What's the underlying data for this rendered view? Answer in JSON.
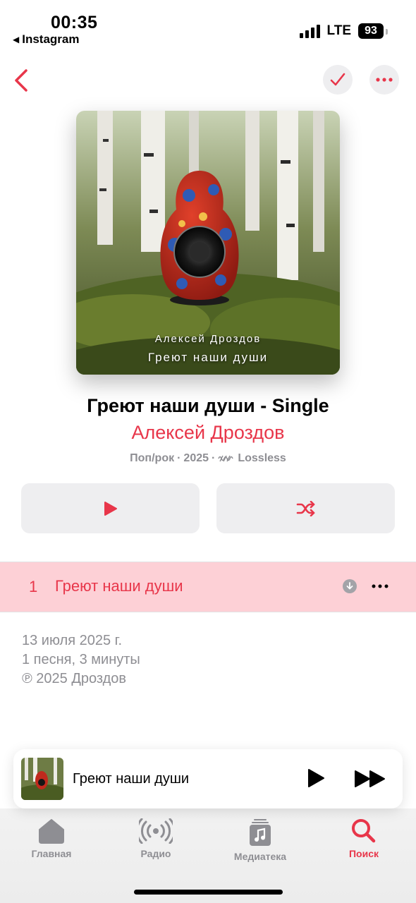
{
  "status_bar": {
    "time": "00:35",
    "back_app": "Instagram",
    "network": "LTE",
    "battery": "93"
  },
  "nav": {
    "back_icon": "chevron-left-icon",
    "check_icon": "checkmark-icon",
    "more_icon": "ellipsis-icon"
  },
  "artwork": {
    "artist_text": "Алексей Дроздов",
    "title_text": "Греют наши души"
  },
  "album": {
    "title": "Греют наши души - Single",
    "artist": "Алексей Дроздов",
    "genre": "Поп/рок",
    "year": "2025",
    "quality": "Lossless"
  },
  "actions": {
    "play_icon": "play-icon",
    "shuffle_icon": "shuffle-icon"
  },
  "tracks": [
    {
      "number": "1",
      "title": "Греют наши души"
    }
  ],
  "info": {
    "release_date": "13 июля 2025 г.",
    "summary": "1 песня, 3 минуты",
    "copyright": "℗ 2025 Дроздов"
  },
  "mini_player": {
    "title": "Греют наши души"
  },
  "tabs": [
    {
      "label": "Главная",
      "icon": "home-icon",
      "active": false
    },
    {
      "label": "Радио",
      "icon": "radio-icon",
      "active": false
    },
    {
      "label": "Медиатека",
      "icon": "library-icon",
      "active": false
    },
    {
      "label": "Поиск",
      "icon": "search-icon",
      "active": true
    }
  ],
  "colors": {
    "accent": "#e8364a",
    "selected_row": "#fdd0d6",
    "secondary_text": "#8e8e93",
    "button_bg": "#eeeef0"
  }
}
